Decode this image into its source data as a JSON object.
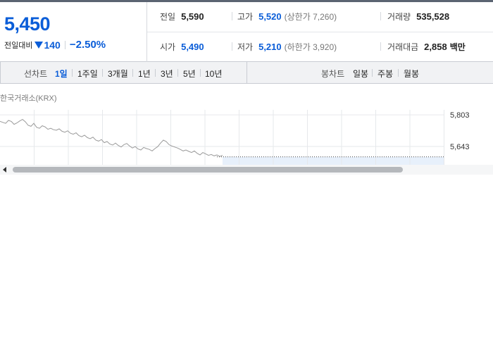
{
  "quote": {
    "price": "5,450",
    "change_label": "전일대비",
    "change_value": "140",
    "change_direction": "down",
    "change_rate": "−2.50%",
    "prev_close_label": "전일",
    "prev_close": "5,590",
    "open_label": "시가",
    "open": "5,490",
    "high_label": "고가",
    "high": "5,520",
    "upper_limit": "(상한가 7,260)",
    "low_label": "저가",
    "low": "5,210",
    "lower_limit": "(하한가 3,920)",
    "volume_label": "거래량",
    "volume": "535,528",
    "turnover_label": "거래대금",
    "turnover": "2,858",
    "turnover_unit": "백만"
  },
  "line_chart_tabs": {
    "title": "선차트",
    "items": [
      "1일",
      "1주일",
      "3개월",
      "1년",
      "3년",
      "5년",
      "10년"
    ],
    "active": "1일"
  },
  "candle_chart_tabs": {
    "title": "봉차트",
    "items": [
      "일봉",
      "주봉",
      "월봉"
    ]
  },
  "chart": {
    "exchange": "한국거래소(KRX)",
    "y_ticks": [
      "5,803",
      "5,643"
    ],
    "colors": {
      "line": "#9a9a9a",
      "future_fill": "#e7f0fb",
      "grid": "#e6e8eb",
      "accent": "#0a5dd8"
    }
  },
  "chart_data": {
    "type": "line",
    "y_ticks": [
      5803,
      5643
    ],
    "ylim": [
      5550,
      5850
    ],
    "prev_close": 5590,
    "series": [
      {
        "values": [
          5770,
          5765,
          5760,
          5775,
          5770,
          5755,
          5762,
          5772,
          5780,
          5768,
          5750,
          5745,
          5760,
          5740,
          5735,
          5748,
          5742,
          5730,
          5735,
          5728,
          5725,
          5732,
          5720,
          5715,
          5722,
          5710,
          5705,
          5712,
          5698,
          5692,
          5700,
          5688,
          5682,
          5690,
          5675,
          5670,
          5678,
          5662,
          5668,
          5655,
          5650,
          5660,
          5648,
          5640,
          5652,
          5658,
          5645,
          5635,
          5642,
          5630,
          5625,
          5638,
          5632,
          5628,
          5620,
          5632,
          5642,
          5660,
          5675,
          5668,
          5652,
          5645,
          5640,
          5635,
          5628,
          5620,
          5625,
          5618,
          5612,
          5620,
          5608,
          5600,
          5612,
          5605,
          5598,
          5602,
          5595,
          5600,
          5592,
          5598
        ]
      }
    ]
  }
}
